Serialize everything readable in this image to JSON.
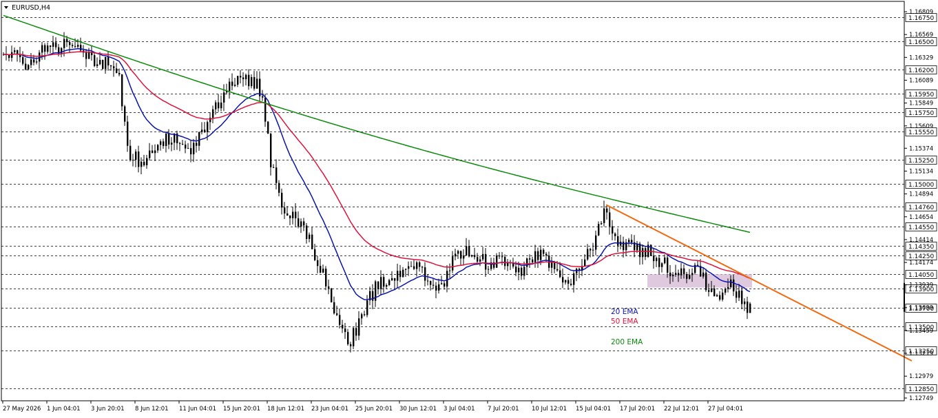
{
  "window": {
    "symbol_label": "EURUSD,H4"
  },
  "colors": {
    "background": "#ffffff",
    "candle": "#000000",
    "grid": "#000000",
    "ema20": "#0a14a8",
    "ema50": "#dc143c",
    "ema200": "#0b8a0b",
    "trendline": "#f26a10",
    "zone": "#d8bfd8",
    "price_tag_bg": "#ffffff"
  },
  "chart_data": {
    "type": "candlestick",
    "title": "EURUSD,H4",
    "ylim": [
      1.12749,
      1.16809
    ],
    "y_ticks": [
      1.16809,
      1.16569,
      1.16329,
      1.16089,
      1.15849,
      1.15609,
      1.15374,
      1.15134,
      1.14894,
      1.14654,
      1.14414,
      1.14174,
      1.13939,
      1.13699,
      1.13459,
      1.13219,
      1.12979,
      1.12749
    ],
    "horizontal_levels": [
      1.1675,
      1.165,
      1.162,
      1.1595,
      1.1575,
      1.1555,
      1.1525,
      1.15,
      1.1476,
      1.1455,
      1.1435,
      1.1425,
      1.1405,
      1.139,
      1.137,
      1.135,
      1.1325,
      1.1285
    ],
    "x_labels": [
      "27 May 2026",
      "1 Jun 04:01",
      "3 Jun 20:01",
      "8 Jun 12:01",
      "11 Jun 04:01",
      "15 Jun 20:01",
      "18 Jun 12:01",
      "23 Jun 04:01",
      "25 Jun 20:01",
      "30 Jun 12:01",
      "3 Jul 04:01",
      "7 Jul 20:01",
      "10 Jul 12:01",
      "15 Jul 04:01",
      "17 Jul 20:01",
      "22 Jul 12:01",
      "27 Jul 04:01"
    ],
    "bars_per_label": 16,
    "total_bars": 272,
    "price_anchors": [
      [
        0,
        1.164
      ],
      [
        8,
        1.1625
      ],
      [
        14,
        1.164
      ],
      [
        22,
        1.1645
      ],
      [
        30,
        1.1635
      ],
      [
        38,
        1.1625
      ],
      [
        42,
        1.1615
      ],
      [
        45,
        1.1535
      ],
      [
        50,
        1.152
      ],
      [
        56,
        1.1545
      ],
      [
        62,
        1.155
      ],
      [
        68,
        1.1535
      ],
      [
        74,
        1.1565
      ],
      [
        80,
        1.1595
      ],
      [
        86,
        1.161
      ],
      [
        92,
        1.1605
      ],
      [
        94,
        1.159
      ],
      [
        97,
        1.1525
      ],
      [
        102,
        1.147
      ],
      [
        108,
        1.146
      ],
      [
        114,
        1.142
      ],
      [
        118,
        1.139
      ],
      [
        122,
        1.135
      ],
      [
        126,
        1.1335
      ],
      [
        132,
        1.1375
      ],
      [
        136,
        1.1395
      ],
      [
        144,
        1.1405
      ],
      [
        150,
        1.1415
      ],
      [
        156,
        1.139
      ],
      [
        160,
        1.1395
      ],
      [
        164,
        1.143
      ],
      [
        170,
        1.1425
      ],
      [
        176,
        1.1415
      ],
      [
        182,
        1.142
      ],
      [
        188,
        1.141
      ],
      [
        194,
        1.1425
      ],
      [
        200,
        1.1415
      ],
      [
        204,
        1.1395
      ],
      [
        208,
        1.1405
      ],
      [
        214,
        1.1435
      ],
      [
        218,
        1.147
      ],
      [
        222,
        1.144
      ],
      [
        228,
        1.1432
      ],
      [
        234,
        1.143
      ],
      [
        238,
        1.142
      ],
      [
        242,
        1.141
      ],
      [
        248,
        1.1405
      ],
      [
        252,
        1.1415
      ],
      [
        256,
        1.1385
      ],
      [
        260,
        1.1378
      ],
      [
        264,
        1.14
      ],
      [
        268,
        1.1375
      ],
      [
        271,
        1.137
      ]
    ],
    "series": [
      {
        "name": "20 EMA",
        "period": 20
      },
      {
        "name": "50 EMA",
        "period": 50
      },
      {
        "name": "200 EMA",
        "period": 200,
        "start_value": 1.1677,
        "end_value": 1.1449
      }
    ],
    "trendline": {
      "start": [
        219,
        1.1478
      ],
      "end": [
        330,
        1.1314
      ]
    },
    "zone": {
      "x_start": 234,
      "x_end": 272,
      "price_high": 1.1405,
      "price_low": 1.1391
    },
    "legend_labels": {
      "ema20": "20 EMA",
      "ema50": "50 EMA",
      "ema200": "200 EMA"
    }
  }
}
